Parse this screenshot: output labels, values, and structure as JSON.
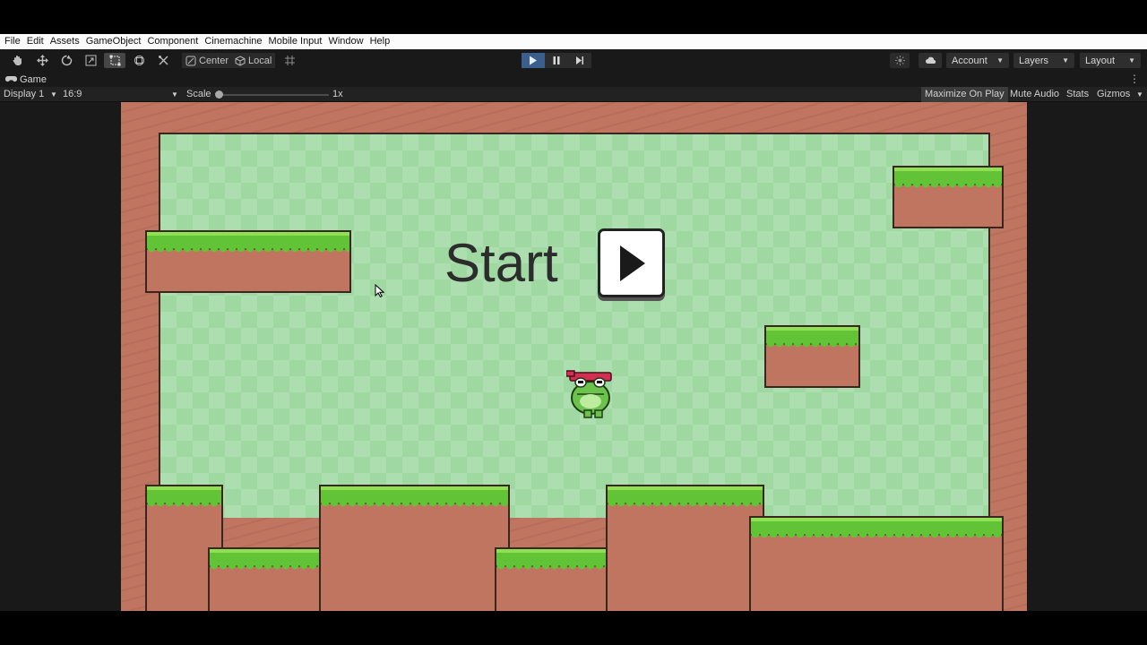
{
  "menu": [
    "File",
    "Edit",
    "Assets",
    "GameObject",
    "Component",
    "Cinemachine",
    "Mobile Input",
    "Window",
    "Help"
  ],
  "toolbar": {
    "tools": [
      "hand-icon",
      "move-icon",
      "rotate-icon",
      "scale-icon",
      "rect-tool-icon",
      "transform-icon",
      "custom-tool-icon"
    ],
    "pivot_center": "Center",
    "pivot_local": "Local",
    "play_state": "playing",
    "account": "Account",
    "layers": "Layers",
    "layout": "Layout",
    "accent": "#3a5f8c"
  },
  "game_tab": {
    "label": "Game"
  },
  "game_bar": {
    "display": "Display 1",
    "aspect": "16:9",
    "scale_label": "Scale",
    "scale_value": "1x",
    "maximize": "Maximize On Play",
    "mute": "Mute Audio",
    "stats": "Stats",
    "gizmos": "Gizmos"
  },
  "game": {
    "start_text": "Start",
    "start_button_icon": "play-triangle-icon",
    "player": "ninja-frog-sprite",
    "colors": {
      "wall": "#bf7560",
      "background": "#a0d8a2",
      "grass": "#63c336"
    }
  }
}
